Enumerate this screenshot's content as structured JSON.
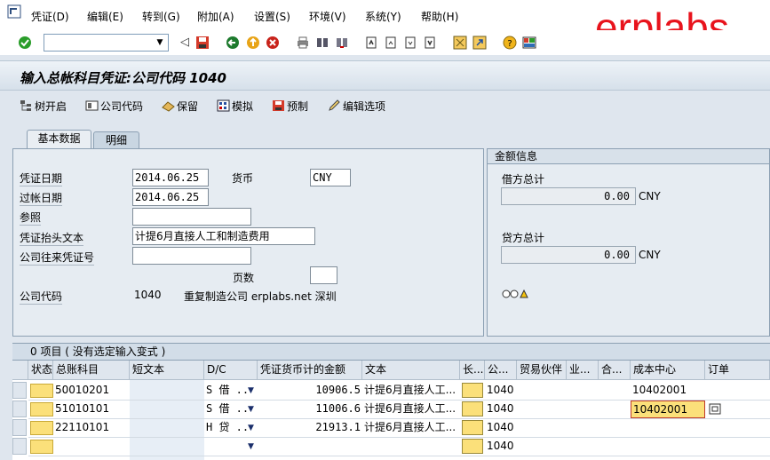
{
  "menu": {
    "items": [
      "凭证(D)",
      "编辑(E)",
      "转到(G)",
      "附加(A)",
      "设置(S)",
      "环境(V)",
      "系统(Y)",
      "帮助(H)"
    ]
  },
  "watermark": "erplabs",
  "toolbar": {
    "command_field": "",
    "icons": [
      "check-icon",
      "back-arrow-icon",
      "save-icon",
      "back-icon",
      "exit-icon",
      "cancel-icon",
      "print-icon",
      "find-icon",
      "find-next-icon",
      "first-page-icon",
      "prev-page-icon",
      "next-page-icon",
      "last-page-icon",
      "create-session-icon",
      "shortcut-icon",
      "help-icon",
      "layout-icon"
    ]
  },
  "page_title": "输入总帐科目凭证:公司代码 1040",
  "app_toolbar": {
    "tree_on": "树开启",
    "company_code": "公司代码",
    "hold": "保留",
    "simulate": "模拟",
    "park": "预制",
    "editing_options": "编辑选项"
  },
  "tabs": [
    "基本数据",
    "明细"
  ],
  "basic_data": {
    "doc_date_label": "凭证日期",
    "doc_date": "2014.06.25",
    "currency_label": "货币",
    "currency": "CNY",
    "posting_date_label": "过帐日期",
    "posting_date": "2014.06.25",
    "reference_label": "参照",
    "reference": "",
    "header_text_label": "凭证抬头文本",
    "header_text": "计提6月直接人工和制造费用",
    "trading_partner_label": "公司往来凭证号",
    "trading_partner": "",
    "page_count_label": "页数",
    "page_count": "",
    "company_code_label": "公司代码",
    "company_code": "1040",
    "company_name": "重复制造公司 erplabs.net 深圳"
  },
  "amount_info": {
    "title": "金额信息",
    "debit_label": "借方总计",
    "debit": "0.00",
    "debit_cur": "CNY",
    "credit_label": "贷方总计",
    "credit": "0.00",
    "credit_cur": "CNY"
  },
  "items_table": {
    "title": "0 项目 ( 没有选定输入变式 )",
    "columns": [
      "状态",
      "总账科目",
      "短文本",
      "D/C",
      "凭证货币计的金额",
      "文本",
      "长...",
      "公...",
      "贸易伙伴",
      "业...",
      "合...",
      "成本中心",
      "订单"
    ],
    "rows": [
      {
        "account": "50010201",
        "dc": "S 借 ..",
        "amount": "10906.5",
        "text": "计提6月直接人工...",
        "company": "1040",
        "cost_center": "10402001"
      },
      {
        "account": "51010101",
        "dc": "S 借 ..",
        "amount": "11006.6",
        "text": "计提6月直接人工...",
        "company": "1040",
        "cost_center": "10402001"
      },
      {
        "account": "22110101",
        "dc": "H 贷 ..",
        "amount": "21913.1",
        "text": "计提6月直接人工...",
        "company": "1040",
        "cost_center": ""
      },
      {
        "account": "",
        "dc": "",
        "amount": "",
        "text": "",
        "company": "1040",
        "cost_center": ""
      }
    ]
  }
}
